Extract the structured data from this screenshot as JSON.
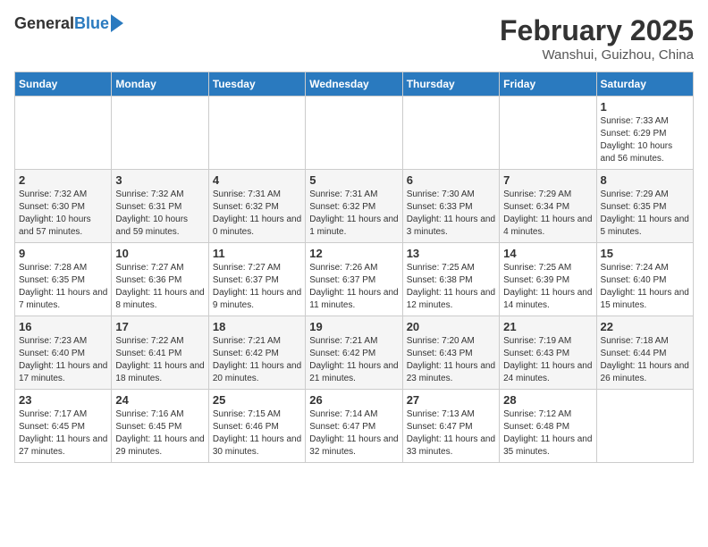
{
  "header": {
    "logo_general": "General",
    "logo_blue": "Blue",
    "month_title": "February 2025",
    "location": "Wanshui, Guizhou, China"
  },
  "days_of_week": [
    "Sunday",
    "Monday",
    "Tuesday",
    "Wednesday",
    "Thursday",
    "Friday",
    "Saturday"
  ],
  "weeks": [
    [
      {
        "day": "",
        "info": ""
      },
      {
        "day": "",
        "info": ""
      },
      {
        "day": "",
        "info": ""
      },
      {
        "day": "",
        "info": ""
      },
      {
        "day": "",
        "info": ""
      },
      {
        "day": "",
        "info": ""
      },
      {
        "day": "1",
        "info": "Sunrise: 7:33 AM\nSunset: 6:29 PM\nDaylight: 10 hours and 56 minutes."
      }
    ],
    [
      {
        "day": "2",
        "info": "Sunrise: 7:32 AM\nSunset: 6:30 PM\nDaylight: 10 hours and 57 minutes."
      },
      {
        "day": "3",
        "info": "Sunrise: 7:32 AM\nSunset: 6:31 PM\nDaylight: 10 hours and 59 minutes."
      },
      {
        "day": "4",
        "info": "Sunrise: 7:31 AM\nSunset: 6:32 PM\nDaylight: 11 hours and 0 minutes."
      },
      {
        "day": "5",
        "info": "Sunrise: 7:31 AM\nSunset: 6:32 PM\nDaylight: 11 hours and 1 minute."
      },
      {
        "day": "6",
        "info": "Sunrise: 7:30 AM\nSunset: 6:33 PM\nDaylight: 11 hours and 3 minutes."
      },
      {
        "day": "7",
        "info": "Sunrise: 7:29 AM\nSunset: 6:34 PM\nDaylight: 11 hours and 4 minutes."
      },
      {
        "day": "8",
        "info": "Sunrise: 7:29 AM\nSunset: 6:35 PM\nDaylight: 11 hours and 5 minutes."
      }
    ],
    [
      {
        "day": "9",
        "info": "Sunrise: 7:28 AM\nSunset: 6:35 PM\nDaylight: 11 hours and 7 minutes."
      },
      {
        "day": "10",
        "info": "Sunrise: 7:27 AM\nSunset: 6:36 PM\nDaylight: 11 hours and 8 minutes."
      },
      {
        "day": "11",
        "info": "Sunrise: 7:27 AM\nSunset: 6:37 PM\nDaylight: 11 hours and 9 minutes."
      },
      {
        "day": "12",
        "info": "Sunrise: 7:26 AM\nSunset: 6:37 PM\nDaylight: 11 hours and 11 minutes."
      },
      {
        "day": "13",
        "info": "Sunrise: 7:25 AM\nSunset: 6:38 PM\nDaylight: 11 hours and 12 minutes."
      },
      {
        "day": "14",
        "info": "Sunrise: 7:25 AM\nSunset: 6:39 PM\nDaylight: 11 hours and 14 minutes."
      },
      {
        "day": "15",
        "info": "Sunrise: 7:24 AM\nSunset: 6:40 PM\nDaylight: 11 hours and 15 minutes."
      }
    ],
    [
      {
        "day": "16",
        "info": "Sunrise: 7:23 AM\nSunset: 6:40 PM\nDaylight: 11 hours and 17 minutes."
      },
      {
        "day": "17",
        "info": "Sunrise: 7:22 AM\nSunset: 6:41 PM\nDaylight: 11 hours and 18 minutes."
      },
      {
        "day": "18",
        "info": "Sunrise: 7:21 AM\nSunset: 6:42 PM\nDaylight: 11 hours and 20 minutes."
      },
      {
        "day": "19",
        "info": "Sunrise: 7:21 AM\nSunset: 6:42 PM\nDaylight: 11 hours and 21 minutes."
      },
      {
        "day": "20",
        "info": "Sunrise: 7:20 AM\nSunset: 6:43 PM\nDaylight: 11 hours and 23 minutes."
      },
      {
        "day": "21",
        "info": "Sunrise: 7:19 AM\nSunset: 6:43 PM\nDaylight: 11 hours and 24 minutes."
      },
      {
        "day": "22",
        "info": "Sunrise: 7:18 AM\nSunset: 6:44 PM\nDaylight: 11 hours and 26 minutes."
      }
    ],
    [
      {
        "day": "23",
        "info": "Sunrise: 7:17 AM\nSunset: 6:45 PM\nDaylight: 11 hours and 27 minutes."
      },
      {
        "day": "24",
        "info": "Sunrise: 7:16 AM\nSunset: 6:45 PM\nDaylight: 11 hours and 29 minutes."
      },
      {
        "day": "25",
        "info": "Sunrise: 7:15 AM\nSunset: 6:46 PM\nDaylight: 11 hours and 30 minutes."
      },
      {
        "day": "26",
        "info": "Sunrise: 7:14 AM\nSunset: 6:47 PM\nDaylight: 11 hours and 32 minutes."
      },
      {
        "day": "27",
        "info": "Sunrise: 7:13 AM\nSunset: 6:47 PM\nDaylight: 11 hours and 33 minutes."
      },
      {
        "day": "28",
        "info": "Sunrise: 7:12 AM\nSunset: 6:48 PM\nDaylight: 11 hours and 35 minutes."
      },
      {
        "day": "",
        "info": ""
      }
    ]
  ]
}
